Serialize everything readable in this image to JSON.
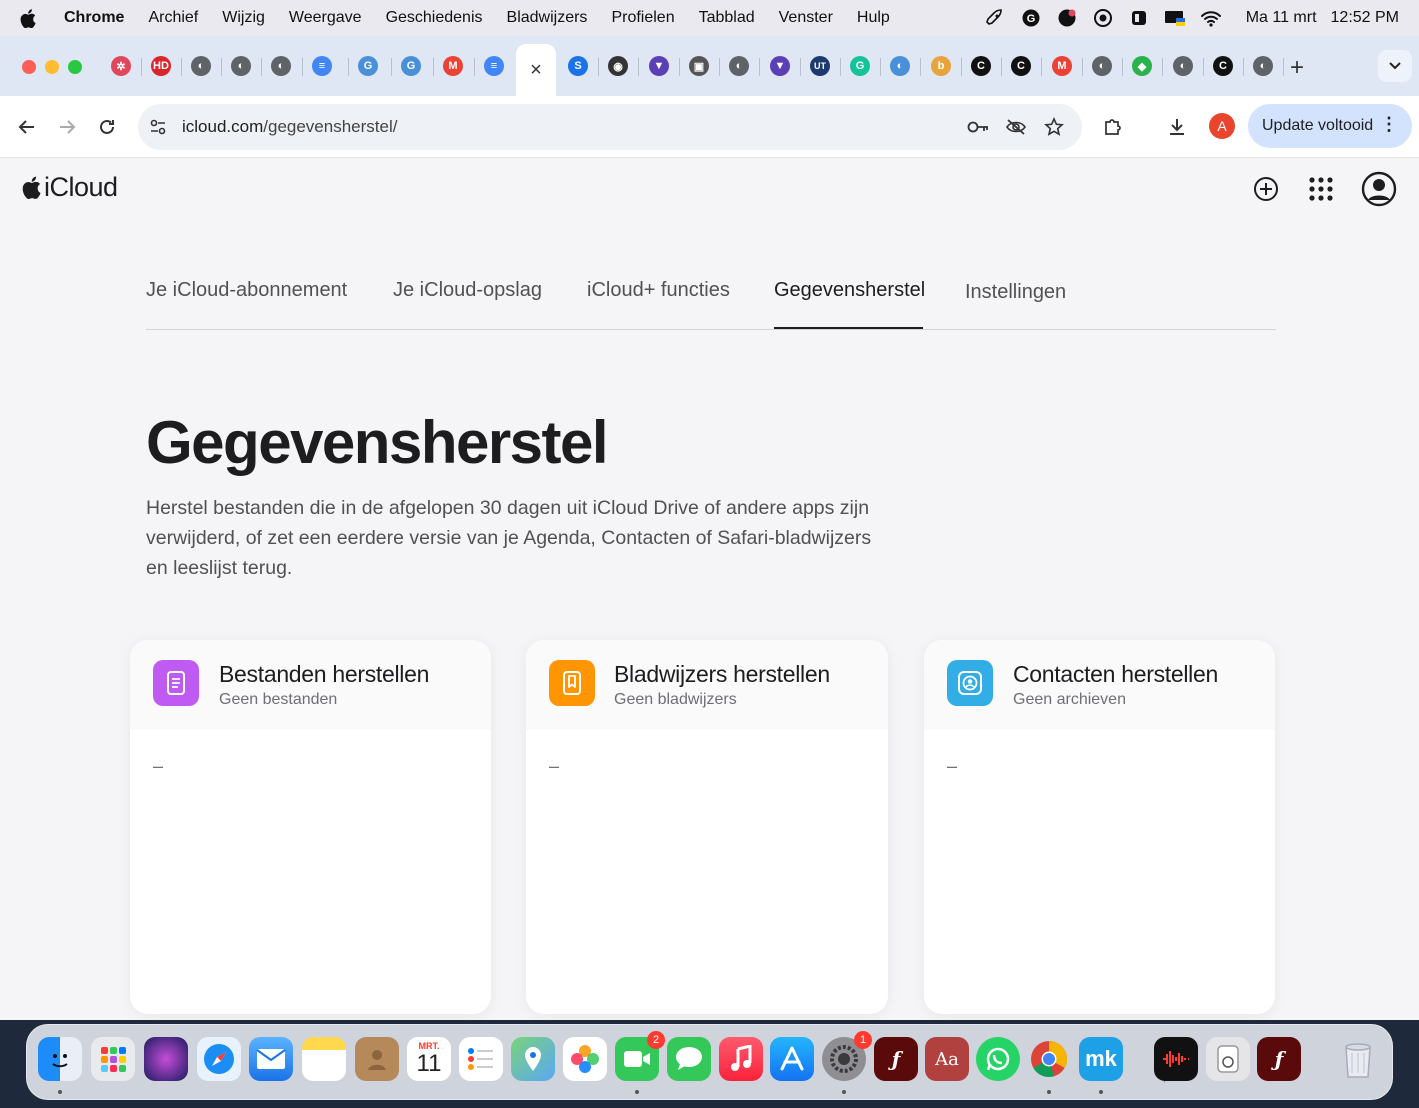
{
  "menubar": {
    "app": "Chrome",
    "items": [
      "Archief",
      "Wijzig",
      "Weergave",
      "Geschiedenis",
      "Bladwijzers",
      "Profielen",
      "Tabblad",
      "Venster",
      "Hulp"
    ],
    "date": "Ma 11 mrt",
    "time": "12:52 PM"
  },
  "tabs": {
    "favicons": [
      {
        "icon": "dots-icon",
        "color": "#e0475b",
        "glyph": "✲"
      },
      {
        "icon": "hd-icon",
        "color": "#d9262c",
        "glyph": "HD"
      },
      {
        "icon": "globe-icon",
        "color": "#5f6368",
        "glyph": "◐"
      },
      {
        "icon": "globe-icon",
        "color": "#5f6368",
        "glyph": "◐"
      },
      {
        "icon": "globe-icon",
        "color": "#5f6368",
        "glyph": "◐"
      },
      {
        "icon": "docs-icon",
        "color": "#4285f4",
        "glyph": "≡"
      },
      {
        "icon": "grammarly-icon",
        "color": "#4a90d9",
        "glyph": "G"
      },
      {
        "icon": "grammarly-icon",
        "color": "#4a90d9",
        "glyph": "G"
      },
      {
        "icon": "gmail-icon",
        "color": "#ea4335",
        "glyph": "M"
      },
      {
        "icon": "docs-icon",
        "color": "#4285f4",
        "glyph": "≡"
      }
    ],
    "active_close": "×",
    "favicons_right": [
      {
        "icon": "sync-icon",
        "color": "#1a73e8",
        "glyph": "S"
      },
      {
        "icon": "target-icon",
        "color": "#333333",
        "glyph": "◉"
      },
      {
        "icon": "shield-icon",
        "color": "#5b3fb5",
        "glyph": "▼"
      },
      {
        "icon": "folder-icon",
        "color": "#555555",
        "glyph": "▣"
      },
      {
        "icon": "globe-icon",
        "color": "#5f6368",
        "glyph": "◐"
      },
      {
        "icon": "shield-icon",
        "color": "#5b3fb5",
        "glyph": "▼"
      },
      {
        "icon": "ut-icon",
        "color": "#1d3a6e",
        "glyph": "UT"
      },
      {
        "icon": "grammarly-icon",
        "color": "#15c39a",
        "glyph": "G"
      },
      {
        "icon": "globe-icon",
        "color": "#4a90d9",
        "glyph": "◐"
      },
      {
        "icon": "bing-icon",
        "color": "#e8a33d",
        "glyph": "b"
      },
      {
        "icon": "c-icon",
        "color": "#111111",
        "glyph": "C"
      },
      {
        "icon": "c-icon",
        "color": "#111111",
        "glyph": "C"
      },
      {
        "icon": "gmail-icon",
        "color": "#ea4335",
        "glyph": "M"
      },
      {
        "icon": "globe-icon",
        "color": "#5f6368",
        "glyph": "◐"
      },
      {
        "icon": "feedly-icon",
        "color": "#2bb24c",
        "glyph": "◆"
      },
      {
        "icon": "globe-icon",
        "color": "#5f6368",
        "glyph": "◐"
      },
      {
        "icon": "c-icon",
        "color": "#111111",
        "glyph": "C"
      },
      {
        "icon": "globe-icon",
        "color": "#5f6368",
        "glyph": "◐"
      }
    ],
    "new_tab": "+"
  },
  "toolbar": {
    "url_host": "icloud.com",
    "url_path": "/gegevensherstel/",
    "profile_initial": "A",
    "update_label": "Update voltooid"
  },
  "icloud": {
    "logo": "iCloud",
    "subnav": [
      "Je iCloud-abonnement",
      "Je iCloud-opslag",
      "iCloud+ functies",
      "Gegevensherstel",
      "Instellingen"
    ],
    "title": "Gegevensherstel",
    "description": "Herstel bestanden die in de afgelopen 30 dagen uit iCloud Drive of andere apps zijn verwijderd, of zet een eerdere versie van je Agenda, Contacten of Safari-bladwijzers en leeslijst terug.",
    "cards": [
      {
        "title": "Bestanden herstellen",
        "subtitle": "Geen bestanden",
        "placeholder": "–",
        "color": "#bf5af2",
        "icon": "document-icon"
      },
      {
        "title": "Bladwijzers herstellen",
        "subtitle": "Geen bladwijzers",
        "placeholder": "–",
        "color": "#ff9500",
        "icon": "bookmark-icon"
      },
      {
        "title": "Contacten herstellen",
        "subtitle": "Geen archieven",
        "placeholder": "–",
        "color": "#32ade6",
        "icon": "contact-icon"
      }
    ]
  },
  "dock": {
    "calendar_month": "MRT.",
    "calendar_day": "11",
    "facetime_badge": "2",
    "settings_badge": "1",
    "dictionary_label": "Aa",
    "mk_label": "mk"
  }
}
